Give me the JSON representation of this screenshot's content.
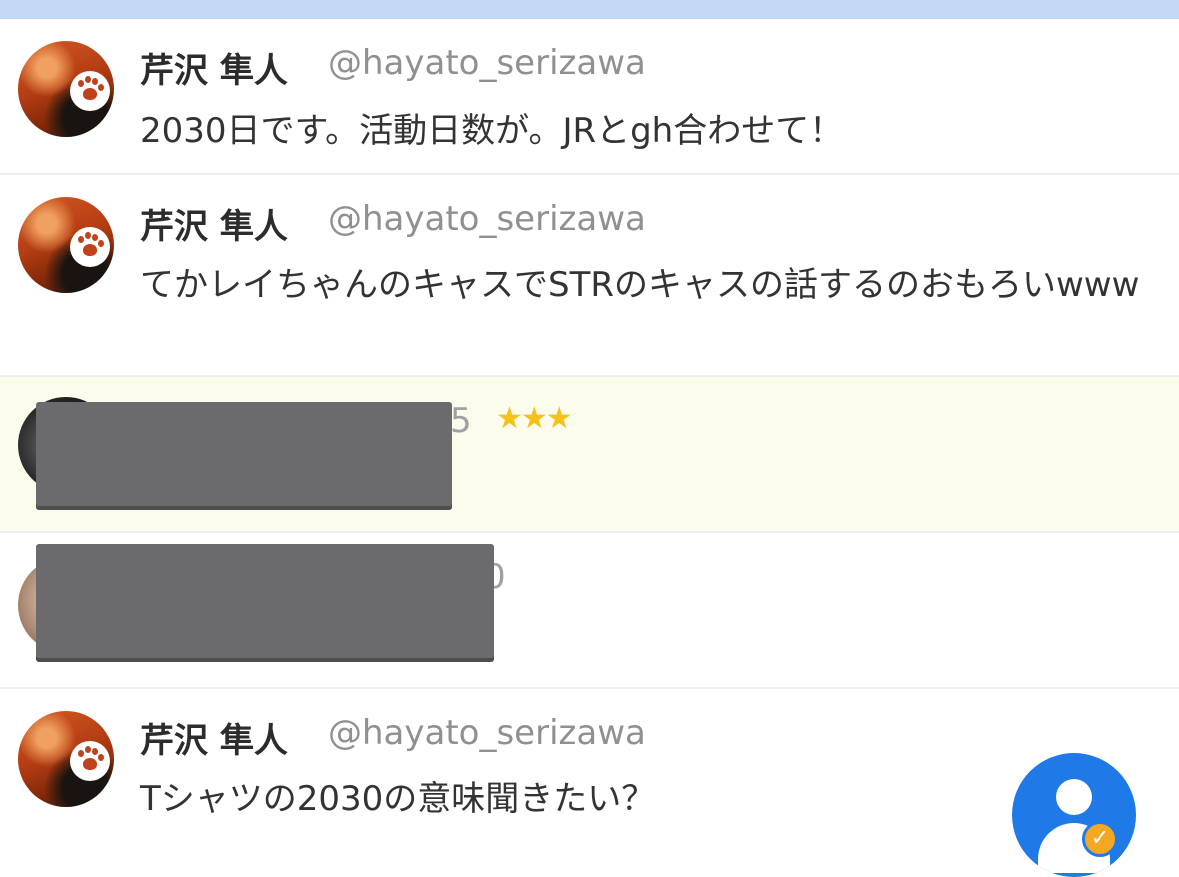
{
  "feed": {
    "items": [
      {
        "name": "芹沢 隼人",
        "handle": "@hayato_serizawa",
        "text": "2030日です。活動日数が。JRとgh合わせて！"
      },
      {
        "name": "芹沢 隼人",
        "handle": "@hayato_serizawa",
        "text": "てかレイちゃんのキャスでSTRのキャスの話するのおもろいwww"
      },
      {
        "handle_fragment": "5",
        "stars": "★★★"
      },
      {
        "handle_fragment": "0"
      },
      {
        "name": "芹沢 隼人",
        "handle": "@hayato_serizawa",
        "text": "Tシャツの2030の意味聞きたい？"
      }
    ]
  },
  "fab": {
    "icon": "account-check-icon",
    "color": "#1f7ae8",
    "badge_color": "#f5a623"
  },
  "header": {
    "color": "#c5d8f6"
  }
}
